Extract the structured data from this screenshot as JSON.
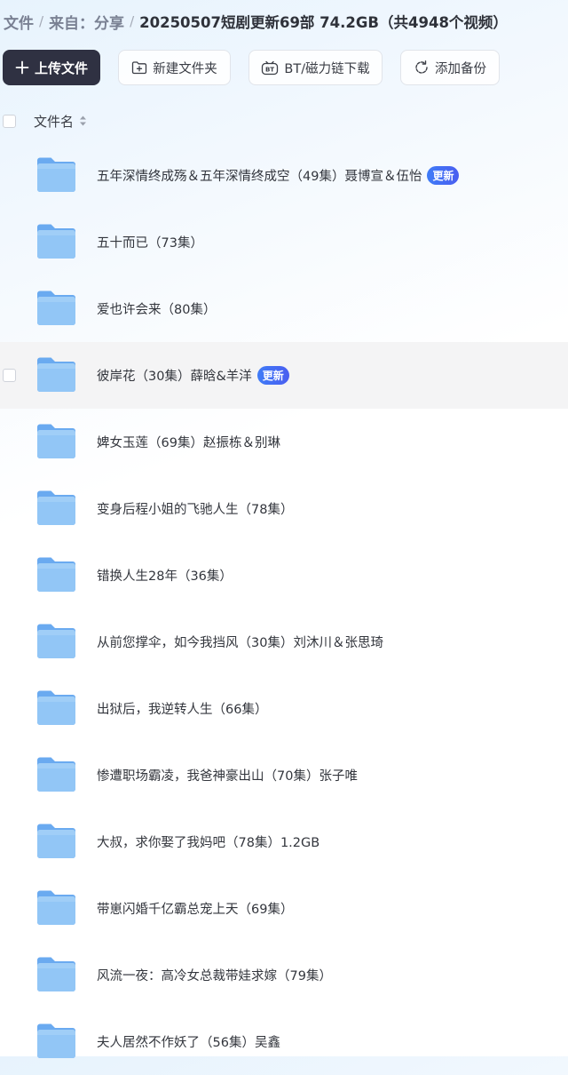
{
  "breadcrumb": {
    "items": [
      "文件",
      "来自：分享"
    ],
    "separator": "/",
    "current": "20250507短剧更新69部 74.2GB（共4948个视频）"
  },
  "toolbar": {
    "upload_label": "上传文件",
    "new_folder_label": "新建文件夹",
    "bt_label": "BT/磁力链下载",
    "backup_label": "添加备份"
  },
  "list": {
    "header_label": "文件名",
    "hovered_index": 3,
    "items": [
      {
        "name": "五年深情终成殇＆五年深情终成空（49集）聂博宣＆伍怡",
        "badge": "更新"
      },
      {
        "name": "五十而已（73集）",
        "badge": ""
      },
      {
        "name": "爱也许会来（80集）",
        "badge": ""
      },
      {
        "name": "彼岸花（30集）薛晗&羊洋",
        "badge": "更新"
      },
      {
        "name": "婢女玉莲（69集）赵振栋＆别琳",
        "badge": ""
      },
      {
        "name": "变身后程小姐的飞驰人生（78集）",
        "badge": ""
      },
      {
        "name": "错换人生28年（36集）",
        "badge": ""
      },
      {
        "name": "从前您撑伞，如今我挡风（30集）刘沐川＆张思琦",
        "badge": ""
      },
      {
        "name": "出狱后，我逆转人生（66集）",
        "badge": ""
      },
      {
        "name": "惨遭职场霸凌，我爸神豪出山（70集）张子唯",
        "badge": ""
      },
      {
        "name": "大叔，求你娶了我妈吧（78集）1.2GB",
        "badge": ""
      },
      {
        "name": "带崽闪婚千亿霸总宠上天（69集）",
        "badge": ""
      },
      {
        "name": "风流一夜：高冷女总裁带娃求嫁（79集）",
        "badge": ""
      },
      {
        "name": "夫人居然不作妖了（56集）吴鑫",
        "badge": ""
      }
    ]
  },
  "colors": {
    "primary_button": "#2f3142",
    "badge": "#4568f2",
    "folder": "#7bb6f2",
    "row_hover": "#f4f4f5"
  },
  "icons": {
    "upload": "plus-icon",
    "new_folder": "folder-plus-icon",
    "bt": "bt-icon",
    "backup": "refresh-icon",
    "sort": "sort-icon",
    "row": "folder-icon"
  }
}
